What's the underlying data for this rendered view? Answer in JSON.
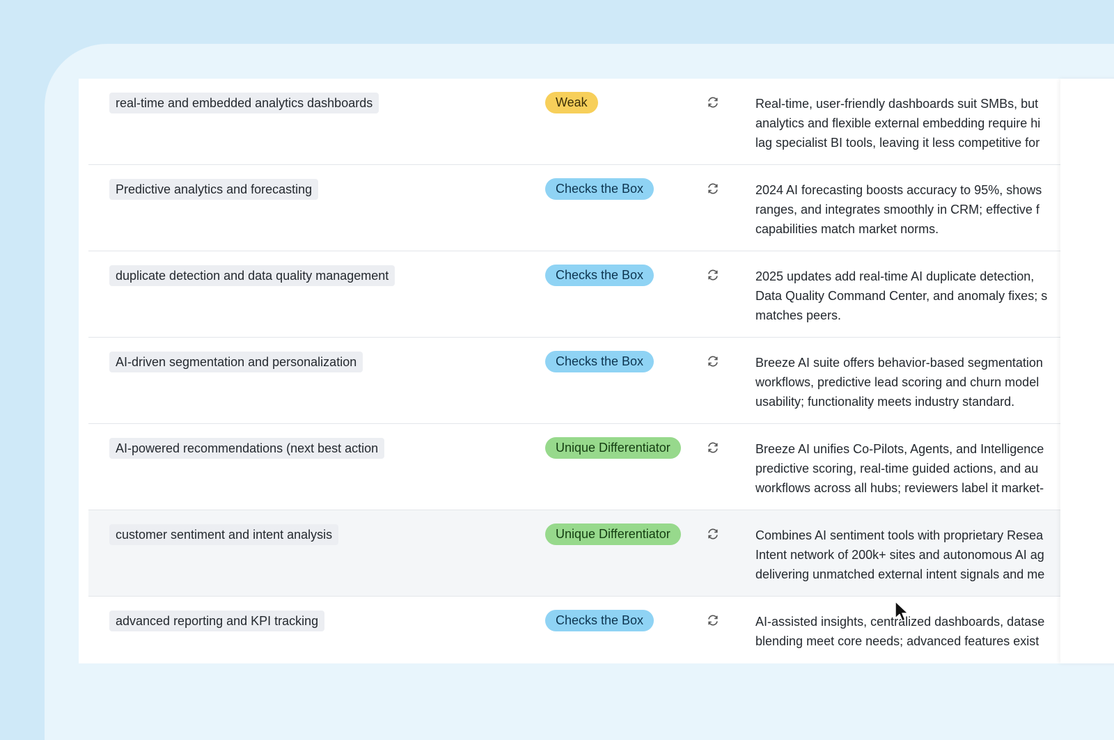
{
  "table": {
    "rows": [
      {
        "feature": "real-time and embedded analytics dashboards",
        "rating": "Weak",
        "rating_kind": "weak",
        "description": "Real-time, user-friendly dashboards suit SMBs, but\nanalytics and flexible external embedding require hi\nlag specialist BI tools, leaving it less competitive for"
      },
      {
        "feature": "Predictive analytics and forecasting",
        "rating": "Checks the Box",
        "rating_kind": "checks",
        "description": "2024 AI forecasting boosts accuracy to 95%, shows\nranges, and integrates smoothly in CRM; effective f\ncapabilities match market norms."
      },
      {
        "feature": "duplicate detection and data quality management",
        "rating": "Checks the Box",
        "rating_kind": "checks",
        "description": "2025 updates add real-time AI duplicate detection,\nData Quality Command Center, and anomaly fixes; s\nmatches peers."
      },
      {
        "feature": "AI-driven segmentation and personalization",
        "rating": "Checks the Box",
        "rating_kind": "checks",
        "description": "Breeze AI suite offers behavior-based segmentation\nworkflows, predictive lead scoring and churn model\nusability; functionality meets industry standard."
      },
      {
        "feature": "AI-powered recommendations (next best action",
        "rating": "Unique Differentiator",
        "rating_kind": "unique",
        "description": "Breeze AI unifies Co-Pilots, Agents, and Intelligence\npredictive scoring, real-time guided actions, and au\nworkflows across all hubs; reviewers label it market-"
      },
      {
        "feature": "customer sentiment and intent analysis",
        "rating": "Unique Differentiator",
        "rating_kind": "unique",
        "description": "Combines AI sentiment tools with proprietary Resea\nIntent network of 200k+ sites and autonomous AI ag\ndelivering unmatched external intent signals and me"
      },
      {
        "feature": "advanced reporting and KPI tracking",
        "rating": "Checks the Box",
        "rating_kind": "checks",
        "description": "AI-assisted insights, centralized dashboards, datase\nblending meet core needs; advanced features exist"
      }
    ],
    "refresh_icon": "refresh-icon",
    "cursor_icon": "mouse-pointer-icon",
    "highlighted_row_index": 5,
    "colors": {
      "weak": "#f7cf5a",
      "checks": "#8fd3f4",
      "unique": "#97d98c"
    }
  }
}
